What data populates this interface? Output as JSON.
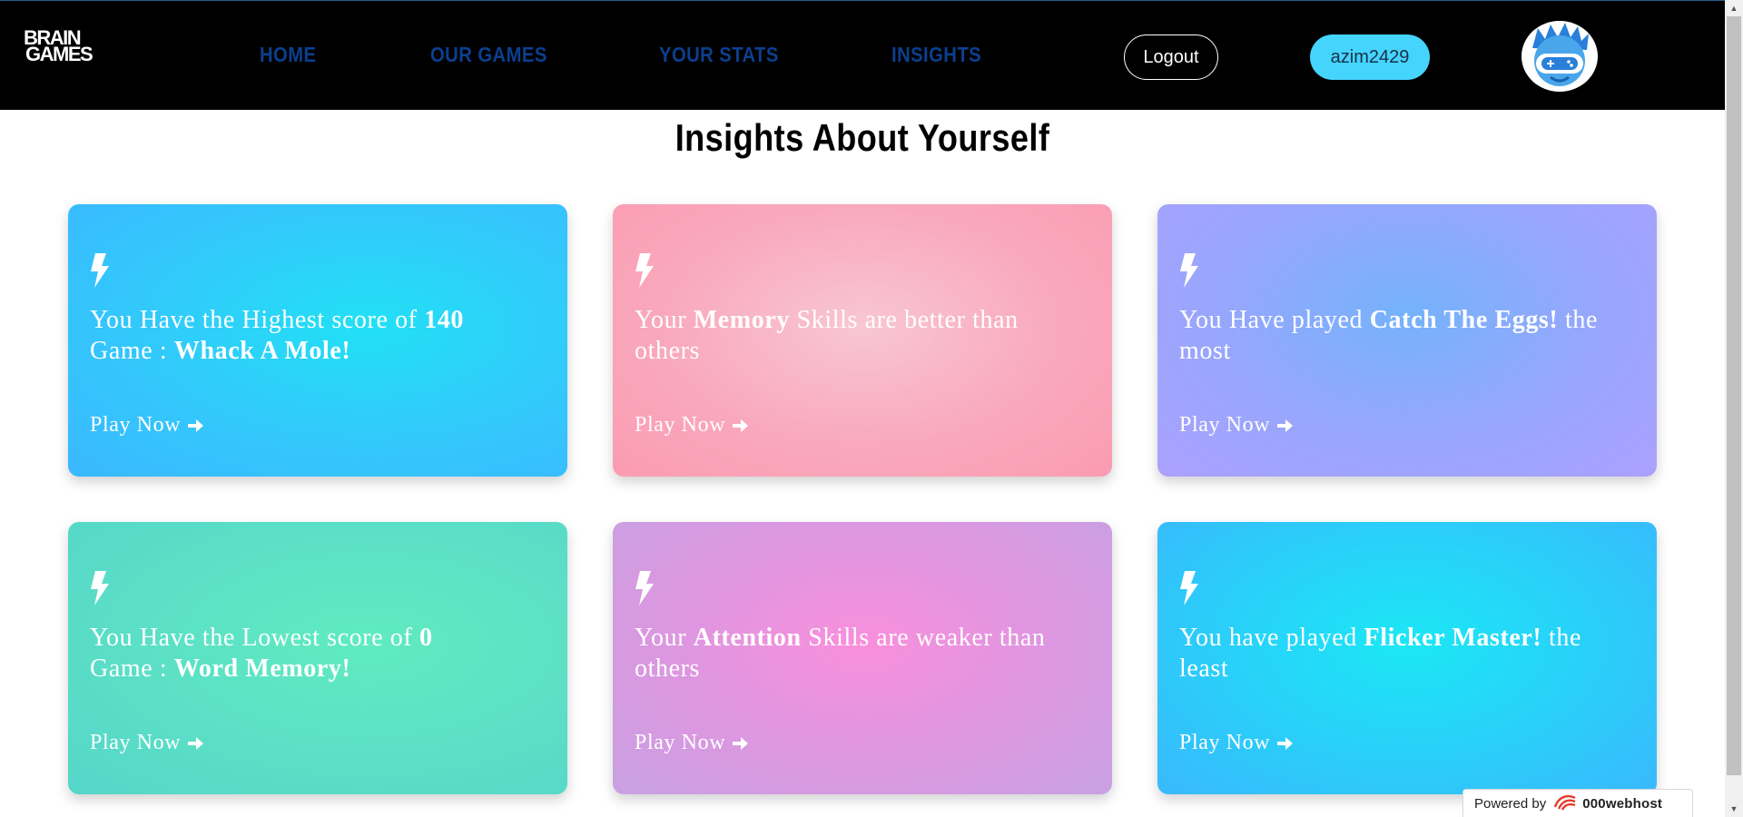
{
  "logo": {
    "line1": "BRAIN",
    "line2": "GAMES"
  },
  "nav": {
    "home": "HOME",
    "our_games": "OUR GAMES",
    "your_stats": "YOUR STATS",
    "insights": "INSIGHTS"
  },
  "header": {
    "logout_label": "Logout",
    "username": "azim2429",
    "avatar_icon": "gamer-avatar-icon"
  },
  "page": {
    "title": "Insights About Yourself"
  },
  "cards": [
    {
      "icon": "lightning-icon",
      "pre": "You Have the Highest score of ",
      "b1": "140",
      "mid": "Game : ",
      "b2": "Whack A Mole!",
      "post": "",
      "play_label": "Play Now"
    },
    {
      "icon": "lightning-icon",
      "pre": "Your ",
      "b1": "Memory",
      "mid": " Skills are better than others",
      "b2": "",
      "post": "",
      "play_label": "Play Now"
    },
    {
      "icon": "lightning-icon",
      "pre": "You Have played ",
      "b1": "Catch The Eggs!",
      "mid": " the most",
      "b2": "",
      "post": "",
      "play_label": "Play Now"
    },
    {
      "icon": "lightning-icon",
      "pre": "You Have the Lowest score of ",
      "b1": "0",
      "mid": "Game : ",
      "b2": "Word Memory!",
      "post": "",
      "play_label": "Play Now"
    },
    {
      "icon": "lightning-icon",
      "pre": "Your ",
      "b1": "Attention",
      "mid": " Skills are weaker than others",
      "b2": "",
      "post": "",
      "play_label": "Play Now"
    },
    {
      "icon": "lightning-icon",
      "pre": "You have played ",
      "b1": "Flicker Master!",
      "mid": " the least",
      "b2": "",
      "post": "",
      "play_label": "Play Now"
    }
  ],
  "badge": {
    "powered_by": "Powered by",
    "brand_prefix": "000",
    "brand_name": "webhost"
  },
  "colors": {
    "navbar_bg": "#000000",
    "nav_link": "#0b3f8f",
    "user_button": "#45d4fc"
  }
}
